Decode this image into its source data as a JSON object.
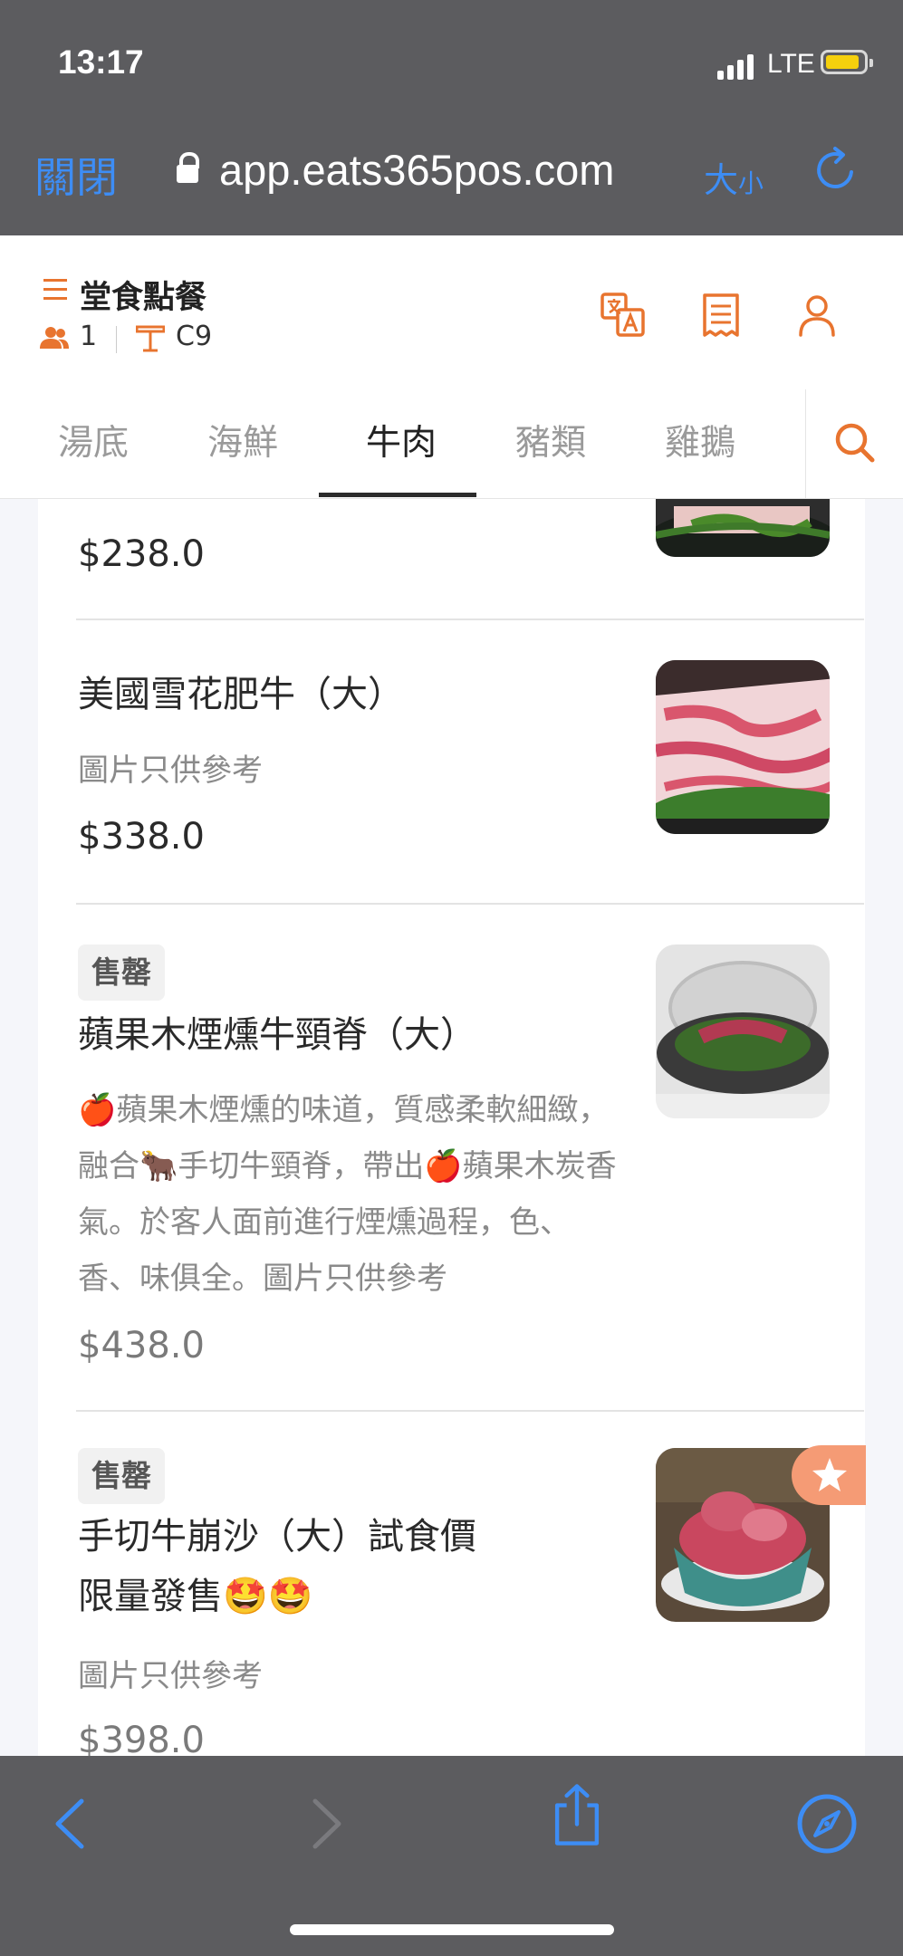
{
  "status": {
    "time": "13:17",
    "network": "LTE"
  },
  "browser": {
    "close_label": "關閉",
    "url": "app.eats365pos.com",
    "size_big": "大",
    "size_small": "小"
  },
  "header": {
    "title": "堂食點餐",
    "guests": "1",
    "table": "C9"
  },
  "tabs": [
    {
      "label": "湯底"
    },
    {
      "label": "海鮮"
    },
    {
      "label": "牛肉",
      "active": true
    },
    {
      "label": "豬類"
    },
    {
      "label": "雞鵝"
    }
  ],
  "items": [
    {
      "price": "$238.0"
    },
    {
      "name": "美國雪花肥牛（大）",
      "note": "圖片只供參考",
      "price": "$338.0"
    },
    {
      "badge": "售罄",
      "name": "蘋果木煙燻牛頸脊（大）",
      "desc": "🍎蘋果木煙燻的味道，質感柔軟細緻，融合🐂手切牛頸脊，帶出🍎蘋果木炭香氣。於客人面前進行煙燻過程，色、香、味俱全。圖片只供參考",
      "price": "$438.0"
    },
    {
      "badge": "售罄",
      "name_line1": "手切牛崩沙（大）試食價",
      "name_line2": "限量發售🤩🤩",
      "note": "圖片只供參考",
      "price": "$398.0"
    }
  ],
  "colors": {
    "accent": "#e8742f",
    "ios_blue": "#3d8df5",
    "chrome": "#5c5c5f"
  }
}
